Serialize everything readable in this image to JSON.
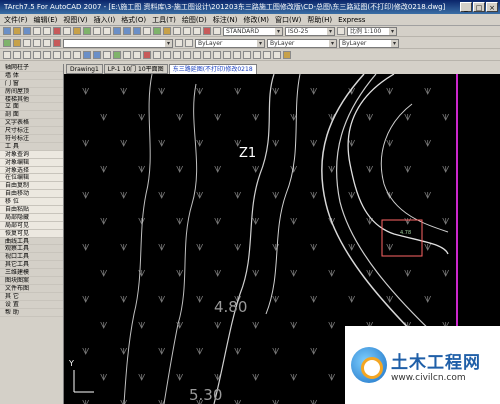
{
  "title": "TArch7.5 For AutoCAD 2007 - [E:\\施工图 资料库\\3-施工图设计\\201203东三路施工图修改版\\CD-总图\\东三路延图(不打印)修改0218.dwg]",
  "window_buttons": [
    "_",
    "□",
    "×"
  ],
  "menu": [
    "文件(F)",
    "编辑(E)",
    "视图(V)",
    "插入(I)",
    "格式(O)",
    "工具(T)",
    "绘图(D)",
    "标注(N)",
    "修改(M)",
    "窗口(W)",
    "帮助(H)",
    "Express"
  ],
  "toolbar": {
    "layer_combo": "ByLayer",
    "color_combo": "ByLayer",
    "linetype_combo": "ByLayer",
    "style_combo": "STANDARD",
    "dim_combo": "ISO-25",
    "scale_combo": "比例 1:100"
  },
  "tabs": [
    "Drawing1",
    "LP-1 10门 10平面图",
    "东三路延图(不打印)修改0218"
  ],
  "sidebar": {
    "items": [
      "轴网柱子",
      "墙 体",
      "门 窗",
      "房间屋顶",
      "楼梯其他",
      "立 面",
      "剖 面",
      "文字表格",
      "尺寸标注",
      "符号标注",
      "工 具",
      "对象查询",
      "对象编辑",
      "对象选择",
      "在位编辑",
      "自由复制",
      "自由移动",
      "移 位",
      "自由粘贴",
      "局部隐藏",
      "局部可见",
      "恢复可见",
      "曲线工具",
      "观察工具",
      "视口工具",
      "其它工具",
      "三维建模",
      "图块图案",
      "文件布图",
      "其 它",
      "设 置",
      "帮 助"
    ]
  },
  "canvas": {
    "label_z1": "Z1",
    "label_480": "4.80",
    "label_530": "5.30",
    "point_label": "4.78",
    "axis_label": "Y"
  },
  "watermark": {
    "title": "土木工程网",
    "url": "www.civilcn.com"
  },
  "colors": {
    "magenta_line": "#ff33ff",
    "road_line": "#d0d0d0",
    "square": "#ff6666"
  }
}
